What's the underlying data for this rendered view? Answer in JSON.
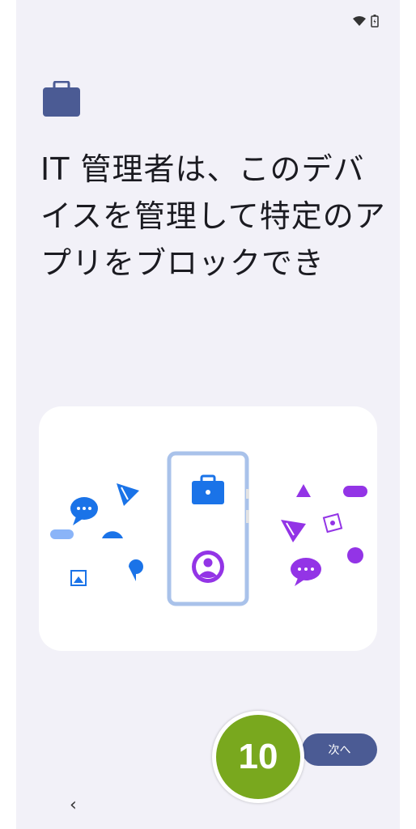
{
  "title": "IT 管理者は、このデバイスを管理して特定のアプリをブロックでき",
  "next_button_label": "次へ",
  "step_marker": "10",
  "back_label": "‹",
  "colors": {
    "accent": "#4b5b94",
    "work_blue": "#1a73e8",
    "personal_purple": "#9334e6",
    "marker_green": "#79a81e"
  }
}
